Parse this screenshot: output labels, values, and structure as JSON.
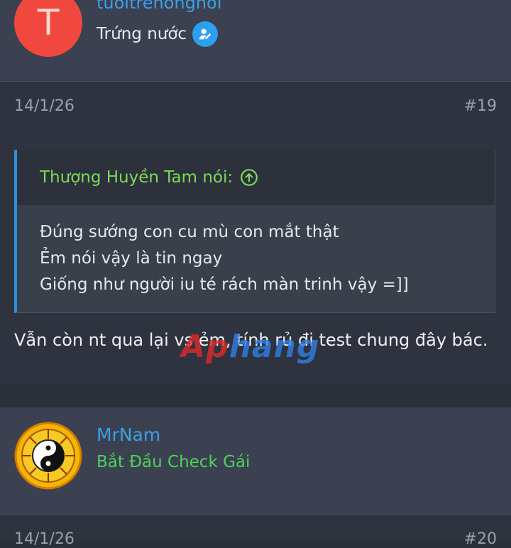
{
  "posts": [
    {
      "avatar_letter": "T",
      "username": "tuoitrenongnoi",
      "rank": "Trứng nước",
      "date": "14/1/26",
      "number": "#19",
      "quote": {
        "author_line": "Thượng Huyền Tam nói:",
        "lines": [
          "Đúng sướng con cu mù con mắt thật",
          "Ẻm nói vậy là tin ngay",
          "Giống như người iu té rách màn trinh vậy =]]"
        ]
      },
      "text": "Vẫn còn nt qua lại vs ẻm, tính rủ đi test chung đây bác."
    },
    {
      "username": "MrNam",
      "rank": "Bắt Đầu Check Gái",
      "date": "14/1/26",
      "number": "#20"
    }
  ],
  "watermark": {
    "part1": "Ap",
    "part2": "hang"
  },
  "colors": {
    "username": "#3aa0e8",
    "quote_author": "#7ed957",
    "rank2": "#4cd35a",
    "badge": "#2d9ff0"
  },
  "icons": {
    "rank_badge": "user-edit-icon",
    "quote_jump": "arrow-up-circle-icon"
  }
}
